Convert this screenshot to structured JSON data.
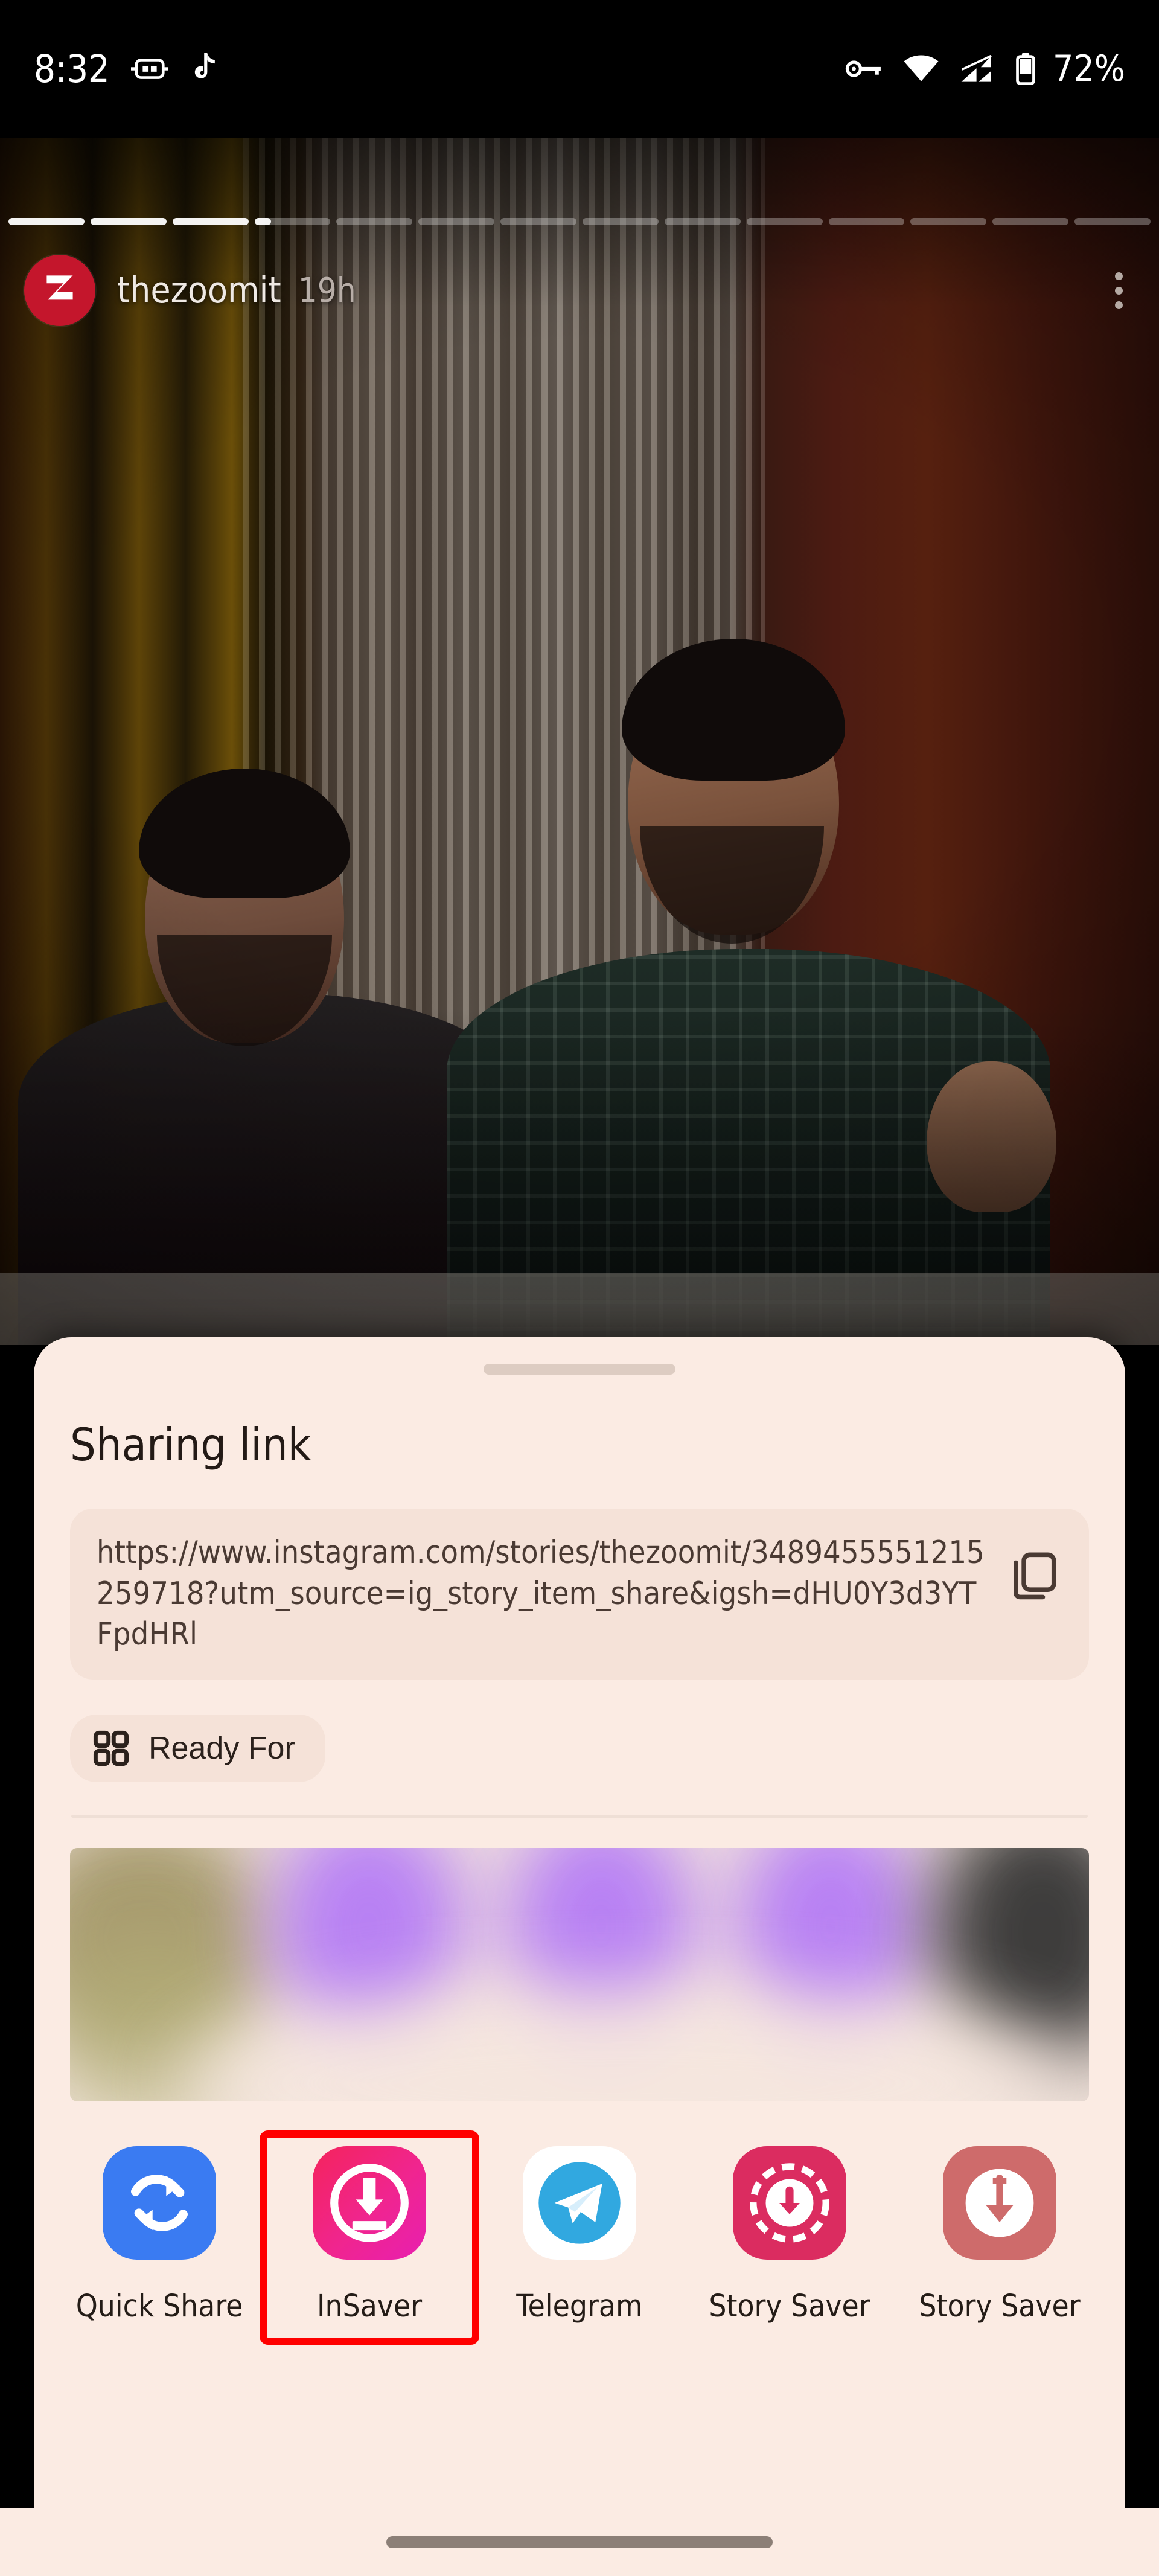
{
  "status_bar": {
    "time": "8:32",
    "battery_percent": "72%",
    "icons": [
      "screen-record-icon",
      "tiktok-music-note-icon",
      "vpn-key-icon",
      "wifi-icon",
      "cellular-signal-icon",
      "battery-icon"
    ]
  },
  "story": {
    "username": "thezoomit",
    "timestamp": "19h",
    "avatar_letter": "Z",
    "avatar_color": "#C4162C",
    "menu_icon": "kebab-menu-icon",
    "progress": {
      "total_segments": 14,
      "completed_segments": 3,
      "current_index": 3,
      "current_fill_percent": 22
    }
  },
  "share_sheet": {
    "title": "Sharing link",
    "link_url": "https://www.instagram.com/stories/thezoomit/3489455551215259718?utm_source=ig_story_item_share&igsh=dHU0Y3d3YTFpdHRl",
    "copy_icon": "copy-icon",
    "chip": {
      "label": "Ready For",
      "icon": "grid-apps-icon"
    },
    "suggestions_blurred": true,
    "sheet_background": "#FBEBE3",
    "card_background": "#F5E2D8",
    "apps": [
      {
        "label": "Quick Share",
        "icon": "quick-share-icon",
        "color": "#3A7BF2",
        "highlighted": false
      },
      {
        "label": "InSaver",
        "icon": "insaver-download-icon",
        "color": "#F02A6E",
        "highlighted": true
      },
      {
        "label": "Telegram",
        "icon": "telegram-icon",
        "color": "#31A8E0",
        "highlighted": false
      },
      {
        "label": "Story Saver",
        "icon": "story-saver-dashed-icon",
        "color": "#DB2C60",
        "highlighted": false
      },
      {
        "label": "Story Saver",
        "icon": "story-saver-arrow-icon",
        "color": "#CE6B6B",
        "highlighted": false
      }
    ],
    "highlight_color": "#FF0000"
  },
  "nav_bar": {
    "gesture_pill": "home-gesture-pill"
  }
}
